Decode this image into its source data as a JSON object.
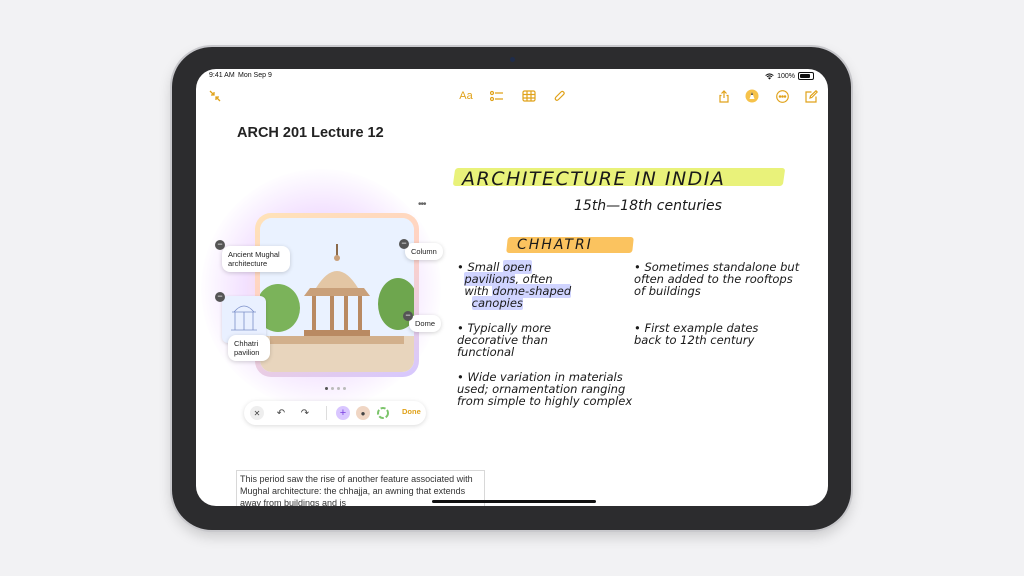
{
  "status": {
    "time": "9:41 AM",
    "date": "Mon Sep 9",
    "battery": "100%"
  },
  "toolbar": {
    "collapse_icon": "arrows-collapse-icon",
    "text_format_label": "Aa",
    "checklist_icon": "checklist-icon",
    "table_icon": "table-icon",
    "attachment_icon": "paperclip-icon",
    "share_icon": "share-icon",
    "markup_icon": "pencil-tip-icon",
    "more_icon": "ellipsis-icon",
    "compose_icon": "compose-icon"
  },
  "note": {
    "title": "ARCH 201 Lecture 12",
    "body_text": "This period saw the rise of another feature associated with Mughal architecture: the chhajja, an awning that extends away from buildings and is"
  },
  "image_playground": {
    "chips": {
      "ancient_mughal": "Ancient Mughal architecture",
      "column": "Column",
      "dome": "Dome",
      "chhatri_pavilion": "Chhatri pavilion"
    },
    "page_count": 4,
    "current_page": 1,
    "done_label": "Done"
  },
  "handwriting": {
    "heading": "ARCHITECTURE IN INDIA",
    "subheading": "15th—18th centuries",
    "section": "CHHATRI",
    "bullets_left": [
      {
        "line1": "Small ",
        "hl1": "open",
        "line2a": "",
        "hl2": "pavilions",
        "line2b": ", often",
        "line3a": "with ",
        "hl3": "dome-shaped",
        "hl4": "canopies"
      },
      {
        "text": "Typically more decorative than functional"
      },
      {
        "text": "Wide variation in materials used; ornamentation ranging from simple to highly complex"
      }
    ],
    "bullets_right": [
      {
        "text": "Sometimes standalone but often added to the rooftops of buildings"
      },
      {
        "text": "First example dates back to 12th century"
      }
    ]
  },
  "colors": {
    "accent": "#e0a21a",
    "highlight_yellow": "#e9f27a",
    "highlight_orange": "#fbc35f",
    "highlight_blue": "#d0d4ff"
  }
}
